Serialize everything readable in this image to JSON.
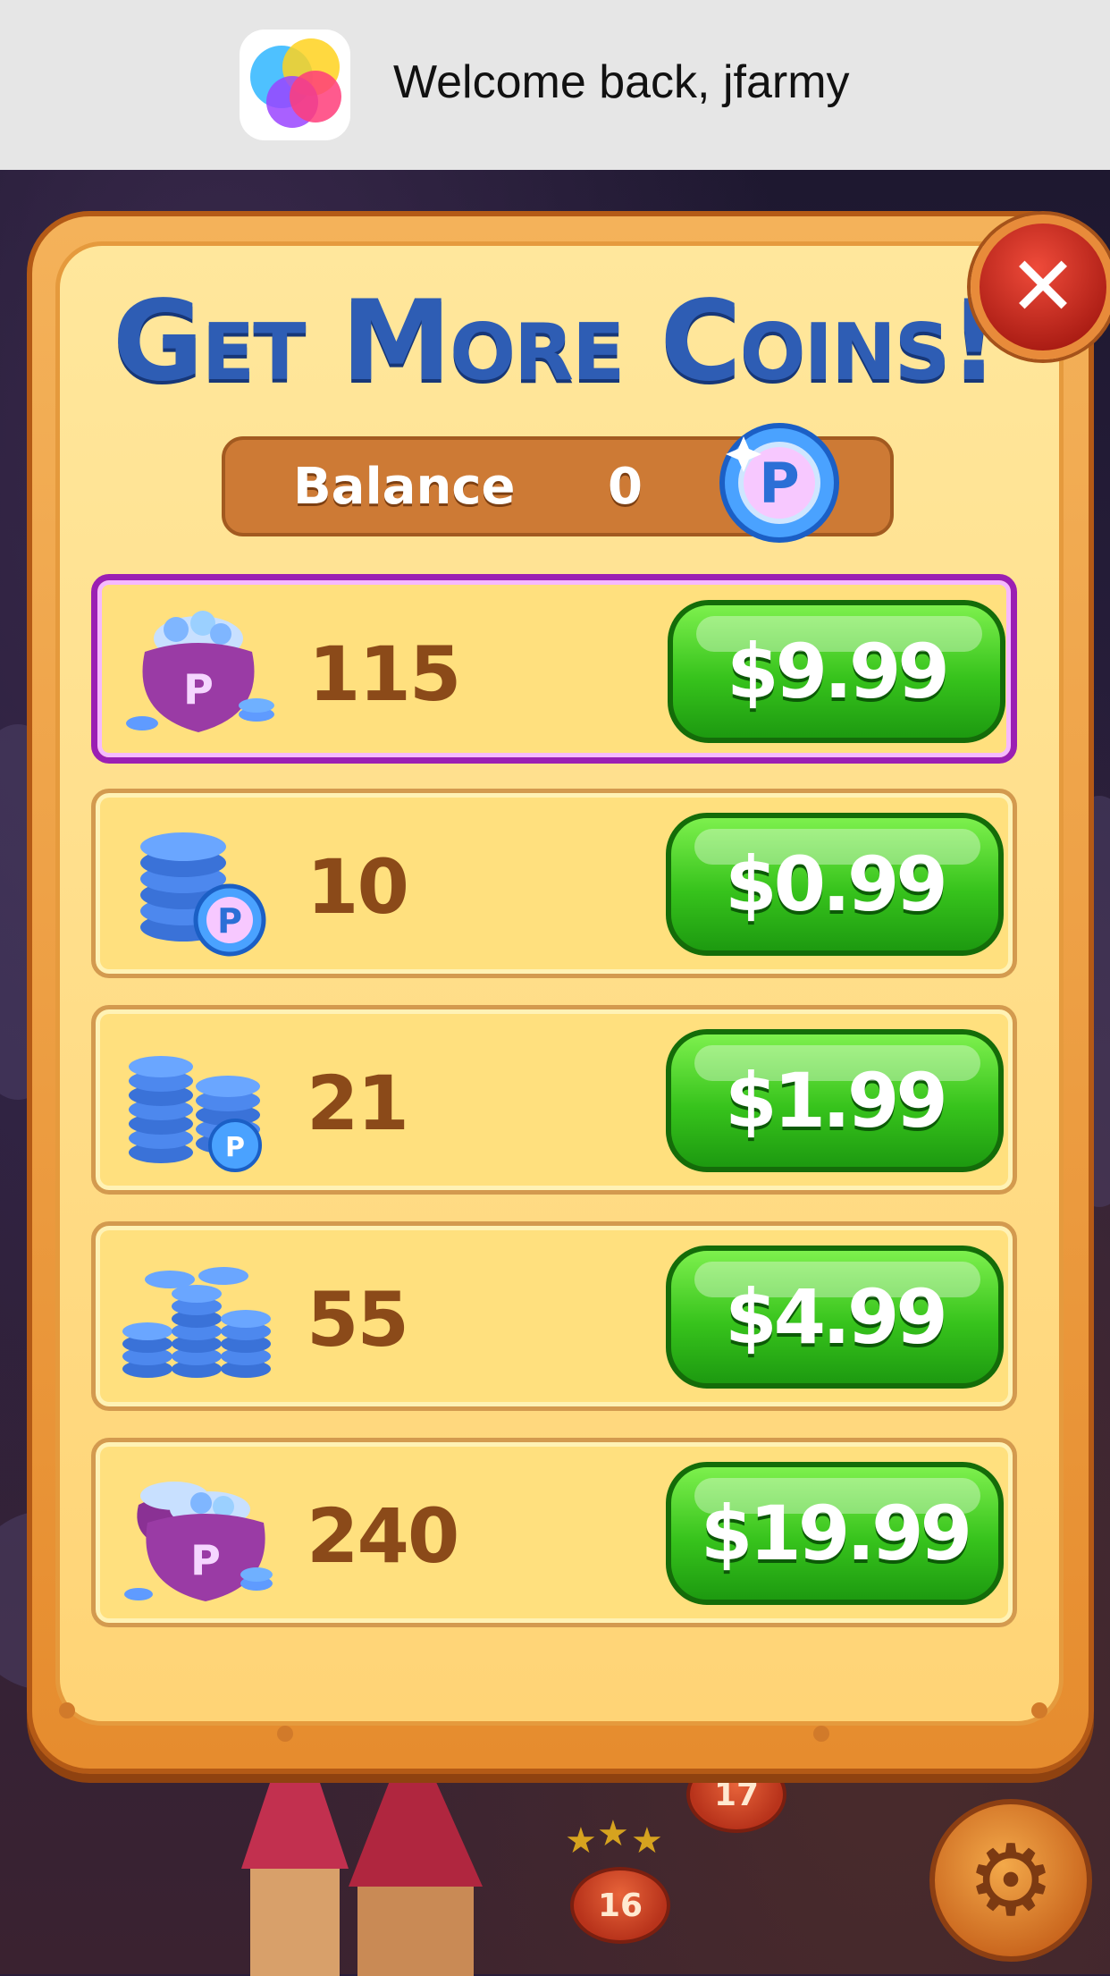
{
  "notification": {
    "app_icon": "game-center-icon",
    "message": "Welcome back, jfarmy"
  },
  "dialog": {
    "title": "Get More Coins!",
    "close_icon": "close-icon",
    "balance": {
      "label": "Balance",
      "value": "0",
      "icon": "coin-icon"
    }
  },
  "offers": [
    {
      "amount": "115",
      "price": "$9.99",
      "icon": "coin-pot-icon",
      "highlighted": true
    },
    {
      "amount": "10",
      "price": "$0.99",
      "icon": "coin-stack-icon",
      "highlighted": false
    },
    {
      "amount": "21",
      "price": "$1.99",
      "icon": "coin-stacks-icon",
      "highlighted": false
    },
    {
      "amount": "55",
      "price": "$4.99",
      "icon": "coin-pile-icon",
      "highlighted": false
    },
    {
      "amount": "240",
      "price": "$19.99",
      "icon": "coin-large-pot-icon",
      "highlighted": false
    }
  ],
  "background": {
    "levels": [
      "17",
      "16"
    ],
    "settings_icon": "gear-icon"
  },
  "colors": {
    "title": "#2e5db4",
    "buy_button": "#37c31c",
    "highlight_border": "#9b1fb3",
    "panel": "#ffe07e"
  }
}
